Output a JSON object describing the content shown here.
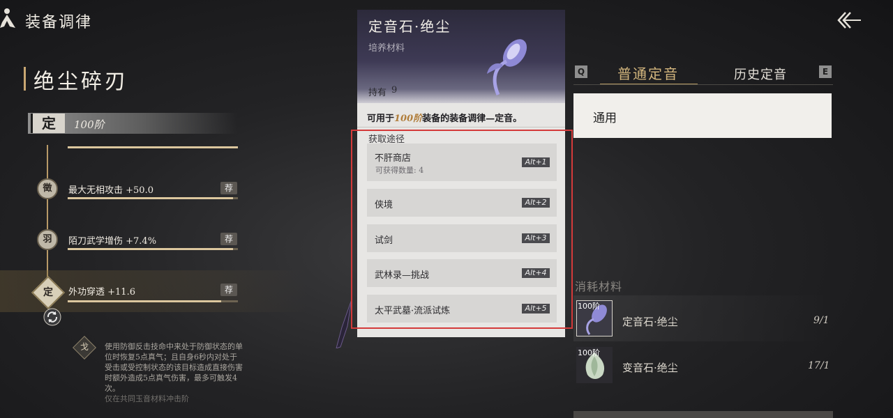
{
  "header": {
    "title": "装备调律",
    "person_icon": "meditation-icon",
    "back_icon": "back-arrow-icon"
  },
  "left": {
    "weapon_name": "绝尘碎刃",
    "tier_badge": "定",
    "tier_label": "100阶",
    "stats": [
      {
        "node": "徵",
        "text": "最大无相攻击 +50.0",
        "rec": "荐",
        "fill": 0.97
      },
      {
        "node": "羽",
        "text": "陌刀武学增伤 +7.4%",
        "rec": "荐",
        "fill": 0.97
      },
      {
        "node": "定",
        "text": "外功穿透 +11.6",
        "rec": "荐",
        "fill": 0.9
      }
    ],
    "top_bar_fill": 1.0,
    "skill_node": "戈",
    "skill_desc": "使用防御反击技命中来处于防御状态的单位时恢复5点真气；且自身6秒内对处于受击或受控制状态的该目标造成直接伤害时额外造成5点真气伤害，最多可触发4次。",
    "skill_desc_tail": "仅在共同玉音材料冲击阶"
  },
  "popup": {
    "title": "定音石·绝尘",
    "subtitle": "培养材料",
    "hold_label": "持有",
    "hold_value": "9",
    "desc_prefix": "可用于",
    "desc_highlight": "100阶",
    "desc_suffix": "装备的装备调律—定音。",
    "sources_title": "获取途径",
    "sources": [
      {
        "name": "不肝商店",
        "sub": "可获得数量: 4",
        "key": "Alt+1"
      },
      {
        "name": "侠境",
        "sub": "",
        "key": "Alt+2"
      },
      {
        "name": "试剑",
        "sub": "",
        "key": "Alt+3"
      },
      {
        "name": "武林录—挑战",
        "sub": "",
        "key": "Alt+4"
      },
      {
        "name": "太平武墓·流派试炼",
        "sub": "",
        "key": "Alt+5"
      }
    ]
  },
  "right": {
    "key_left": "Q",
    "key_right": "E",
    "tabs": [
      "普通定音",
      "历史定音"
    ],
    "option": "通用",
    "consume_title": "消耗材料",
    "materials": [
      {
        "tier": "100阶",
        "name": "定音石·绝尘",
        "count": "9/1",
        "icon": "tuning-stone-icon"
      },
      {
        "tier": "100阶",
        "name": "变音石·绝尘",
        "count": "17/1",
        "icon": "changing-stone-icon"
      }
    ]
  },
  "colors": {
    "accent_gold": "#c9a772",
    "highlight_red": "#d43a3a",
    "tier_orange": "#b07d3a"
  }
}
